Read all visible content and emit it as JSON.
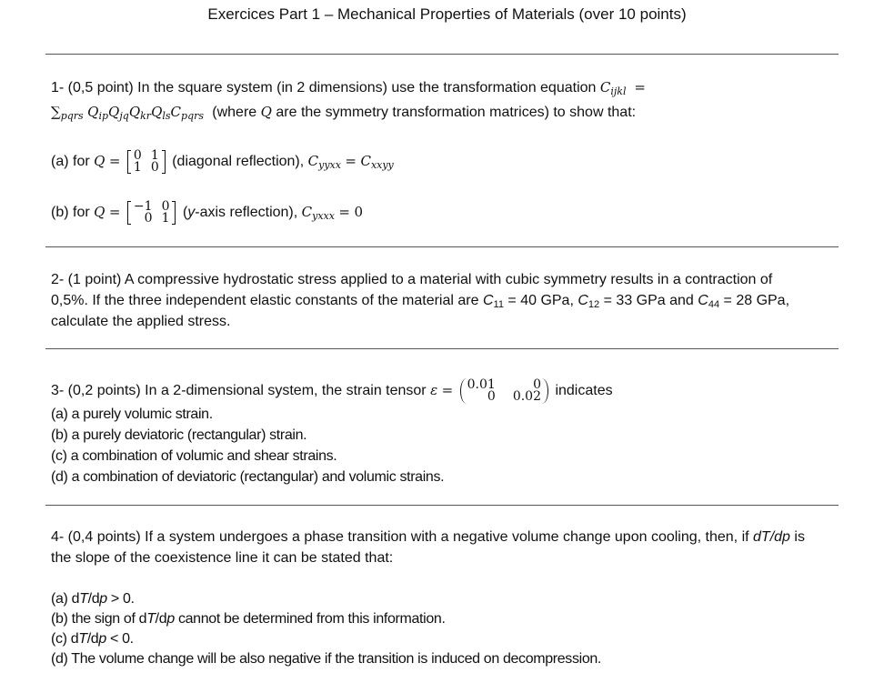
{
  "title": "Exercices Part 1 – Mechanical Properties of Materials (over 10 points)",
  "q1": {
    "line1_text": "1- (0,5 point) In the square system (in 2 dimensions) use the transformation equation",
    "eq_lhs": "C",
    "eq_lhs_sub": "ijkl",
    "eq_equals": "=",
    "sum_symbol": "∑",
    "sum_sub": "pqrs",
    "products": [
      {
        "sym": "Q",
        "sub": "ip"
      },
      {
        "sym": "Q",
        "sub": "jq"
      },
      {
        "sym": "Q",
        "sub": "kr"
      },
      {
        "sym": "Q",
        "sub": "ls"
      },
      {
        "sym": "C",
        "sub": "pqrs"
      }
    ],
    "line2_pre": "(where",
    "line2_q": "Q",
    "line2_post": "are the symmetry transformation matrices) to show that:",
    "part_a": {
      "prefix": "(a) for",
      "q": "Q",
      "eq": "=",
      "matrix": [
        [
          "0",
          "1"
        ],
        [
          "1",
          "0"
        ]
      ],
      "desc": "(diagonal reflection),",
      "lhs": "C",
      "lhs_sub": "yyxx",
      "rel": "=",
      "rhs": "C",
      "rhs_sub": "xxyy"
    },
    "part_b": {
      "prefix": "(b) for",
      "q": "Q",
      "eq": "=",
      "matrix": [
        [
          "−1",
          "0"
        ],
        [
          "0",
          "1"
        ]
      ],
      "desc_italic": "y",
      "desc": "-axis reflection),",
      "desc_open": "(",
      "lhs": "C",
      "lhs_sub": "yxxx",
      "rel": "=",
      "rhs": "0"
    }
  },
  "q2": {
    "line1": "2- (1 point) A compressive hydrostatic stress applied to a material with cubic symmetry results in a contraction of",
    "line2_pre": "0,5%. If the three independent elastic constants of the material are",
    "constants": [
      {
        "sym": "C",
        "sub": "11",
        "value": "= 40 GPa,"
      },
      {
        "sym": "C",
        "sub": "12",
        "value": "= 33 GPa and"
      },
      {
        "sym": "C",
        "sub": "44",
        "value": "= 28 GPa,"
      }
    ],
    "line3": "calculate the applied stress."
  },
  "q3": {
    "stem_pre": "3- (0,2 points) In a 2-dimensional system, the strain tensor",
    "epsilon": "ε",
    "eq": "=",
    "matrix": [
      [
        "0.01",
        "0"
      ],
      [
        "0",
        "0.02"
      ]
    ],
    "stem_post": "indicates",
    "options": [
      "(a) a purely volumic strain.",
      "(b) a purely deviatoric (rectangular) strain.",
      "(c) a combination of volumic and shear strains.",
      "(d) a combination of deviatoric (rectangular) and volumic strains."
    ]
  },
  "q4": {
    "line1_pre": "4- (0,4 points) If a system undergoes a phase transition with a negative volume change upon cooling, then, if",
    "line1_var": "dT/dp",
    "line1_post": "is",
    "line2": "the slope of the coexistence line it can be stated that:",
    "options": [
      {
        "pre": "(a) d",
        "T": "T",
        "mid": "/d",
        "p": "p",
        "post": " > 0."
      },
      {
        "pre": "(b) the sign of d",
        "T": "T",
        "mid": "/d",
        "p": "p",
        "post": " cannot be determined from this information."
      },
      {
        "pre": "(c) d",
        "T": "T",
        "mid": "/d",
        "p": "p",
        "post": " < 0."
      },
      {
        "pre": "(d) The volume change will be also negative if the transition is induced on decompression.",
        "T": "",
        "mid": "",
        "p": "",
        "post": ""
      }
    ]
  }
}
